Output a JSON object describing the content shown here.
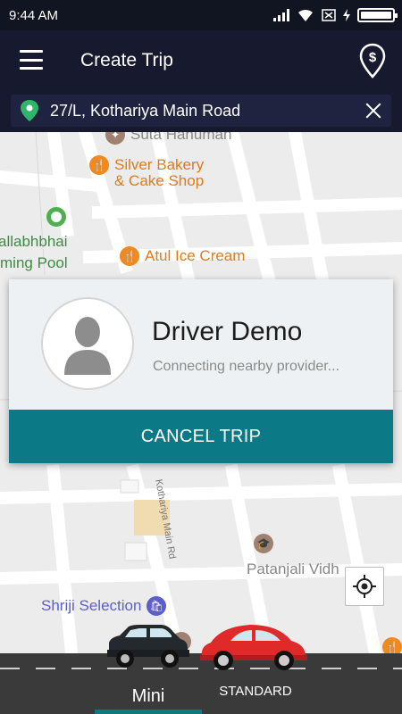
{
  "status_bar": {
    "time": "9:44 AM"
  },
  "app_bar": {
    "title": "Create Trip"
  },
  "search": {
    "address": "27/L, Kothariya Main Road"
  },
  "map": {
    "pois": [
      {
        "name": "Suta Hanuman"
      },
      {
        "name": "Silver Bakery"
      },
      {
        "name": "& Cake Shop"
      },
      {
        "name": "allabhbhai"
      },
      {
        "name": "ming Pool"
      },
      {
        "name": "Atul Ice Cream"
      },
      {
        "name": "Patanjali Vidh"
      },
      {
        "name": "Shriji Selection"
      }
    ],
    "road_label": "Kothariya Main Rd"
  },
  "driver_card": {
    "name": "Driver Demo",
    "status": "Connecting nearby provider...",
    "cancel_label": "CANCEL TRIP"
  },
  "vehicles": {
    "tabs": [
      {
        "label": "Mini"
      },
      {
        "label": "STANDARD"
      }
    ]
  },
  "colors": {
    "app_bar": "#171a2e",
    "accent": "#0b7a86",
    "poi_orange": "#e07b1a"
  }
}
